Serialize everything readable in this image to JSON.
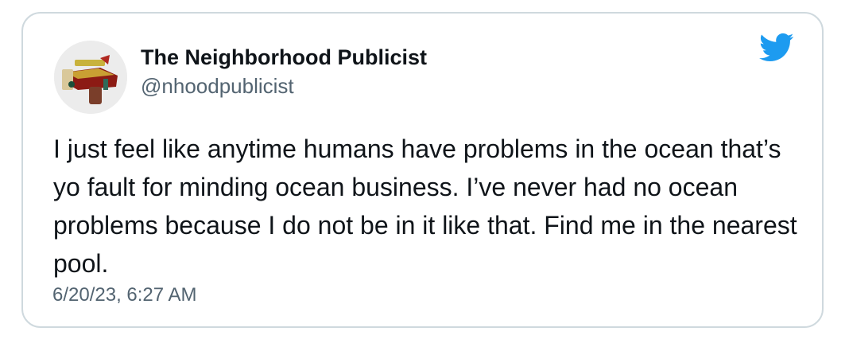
{
  "tweet": {
    "author": {
      "display_name": "The Neighborhood Publicist",
      "handle": "@nhoodpublicist",
      "avatar_icon": "logo-avatar-icon"
    },
    "platform_icon": "twitter-bird-icon",
    "brand_color": "#1d9bf0",
    "text": "I just feel like anytime humans have problems in the ocean that’s yo fault for minding ocean business. I’ve never had no ocean problems because I do not be in it like that. Find me in the nearest pool.",
    "timestamp": "6/20/23, 6:27 AM"
  }
}
